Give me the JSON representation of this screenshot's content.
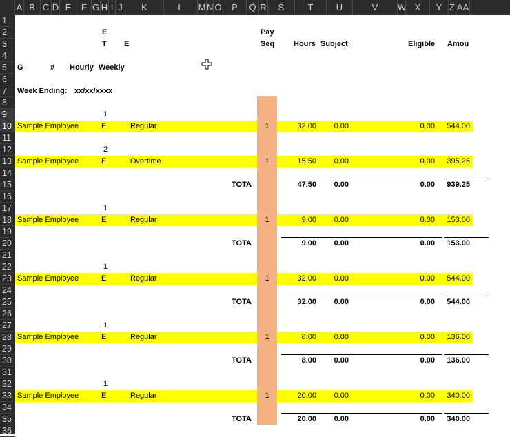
{
  "columns": [
    "",
    "A",
    "B",
    "C",
    "D",
    "E",
    "F",
    "G",
    "H",
    "I",
    "J",
    "K",
    "L",
    "M",
    "N",
    "O",
    "P",
    "Q",
    "R",
    "S",
    "T",
    "U",
    "V",
    "W",
    "X",
    "Y",
    "Z",
    "AA"
  ],
  "rows": [
    "1",
    "2",
    "3",
    "4",
    "5",
    "6",
    "7",
    "8",
    "9",
    "10",
    "11",
    "12",
    "13",
    "14",
    "15",
    "16",
    "17",
    "18",
    "19",
    "20",
    "21",
    "22",
    "23",
    "24",
    "25",
    "26",
    "27",
    "28",
    "29",
    "30",
    "31",
    "32",
    "33",
    "34",
    "35",
    "36"
  ],
  "headers": {
    "r2_g": "E",
    "r2_q": "Pay",
    "r3_g": "T",
    "r3_j": "E",
    "r3_q": "Seq",
    "r3_s": "Hours",
    "r3_t": "Subject",
    "r3_v": "Eligible",
    "r3_x": "Amou",
    "r5_a": "G",
    "r5_c": "#",
    "r5_e": "Hourly",
    "r5_g": "Weekly",
    "r7_a": "Week Ending:",
    "r7_date": "xx/xx/xxxx"
  },
  "groups": [
    {
      "lines": [
        {
          "num": "1",
          "name": "Sample Employee",
          "et": "E",
          "type": "Regular",
          "seq": "1",
          "hours": "32.00",
          "subject": "0.00",
          "eligible": "0.00",
          "amount": "544.00"
        },
        {
          "num": "2",
          "name": "Sample Employee",
          "et": "E",
          "type": "Overtime",
          "seq": "1",
          "hours": "15.50",
          "subject": "0.00",
          "eligible": "0.00",
          "amount": "395.25"
        }
      ],
      "total": {
        "label": "TOTA",
        "hours": "47.50",
        "subject": "0.00",
        "eligible": "0.00",
        "amount": "939.25"
      }
    },
    {
      "lines": [
        {
          "num": "1",
          "name": "Sample Employee",
          "et": "E",
          "type": "Regular",
          "seq": "1",
          "hours": "9.00",
          "subject": "0.00",
          "eligible": "0.00",
          "amount": "153.00"
        }
      ],
      "total": {
        "label": "TOTA",
        "hours": "9.00",
        "subject": "0.00",
        "eligible": "0.00",
        "amount": "153.00"
      }
    },
    {
      "lines": [
        {
          "num": "1",
          "name": "Sample Employee",
          "et": "E",
          "type": "Regular",
          "seq": "1",
          "hours": "32.00",
          "subject": "0.00",
          "eligible": "0.00",
          "amount": "544.00"
        }
      ],
      "total": {
        "label": "TOTA",
        "hours": "32.00",
        "subject": "0.00",
        "eligible": "0.00",
        "amount": "544.00"
      }
    },
    {
      "lines": [
        {
          "num": "1",
          "name": "Sample Employee",
          "et": "E",
          "type": "Regular",
          "seq": "1",
          "hours": "8.00",
          "subject": "0.00",
          "eligible": "0.00",
          "amount": "136.00"
        }
      ],
      "total": {
        "label": "TOTA",
        "hours": "8.00",
        "subject": "0.00",
        "eligible": "0.00",
        "amount": "136.00"
      }
    },
    {
      "lines": [
        {
          "num": "1",
          "name": "Sample Employee",
          "et": "E",
          "type": "Regular",
          "seq": "1",
          "hours": "20.00",
          "subject": "0.00",
          "eligible": "0.00",
          "amount": "340.00"
        }
      ],
      "total": {
        "label": "TOTA",
        "hours": "20.00",
        "subject": "0.00",
        "eligible": "0.00",
        "amount": "340.00"
      }
    }
  ],
  "colors": {
    "highlight": "#ffff00",
    "selected_column": "#f4b183",
    "header_bg": "#2b2b2b"
  },
  "icons": {
    "cursor": "cross-move-cursor-icon"
  }
}
